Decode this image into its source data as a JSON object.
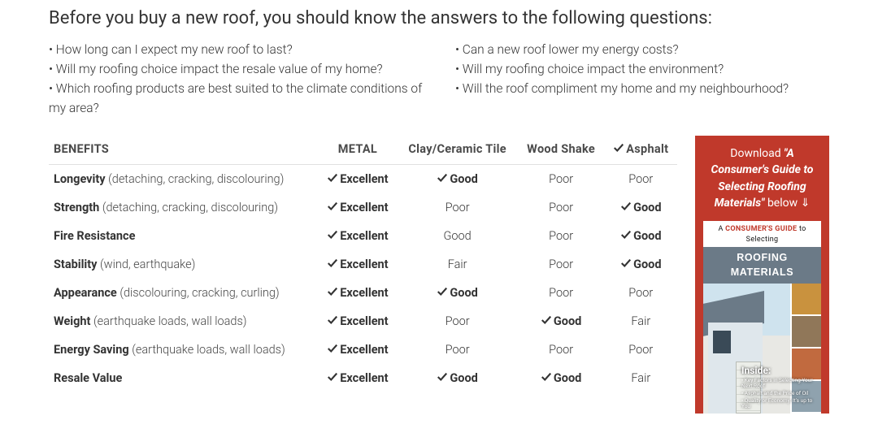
{
  "heading": "Before you buy a new roof, you should know the answers to the following questions:",
  "questions_left": [
    "• How long can I expect my new roof to last?",
    "• Will my roofing choice impact the resale value of my home?",
    "• Which roofing products are best suited to the climate conditions of my area?"
  ],
  "questions_right": [
    "• Can a new roof lower my energy costs?",
    "• Will my roofing choice impact the environment?",
    "• Will the roof compliment my home and my neighbourhood?"
  ],
  "table": {
    "columns": [
      {
        "label": "BENEFITS",
        "check": false
      },
      {
        "label": "METAL",
        "check": false
      },
      {
        "label": "Clay/Ceramic Tile",
        "check": false
      },
      {
        "label": "Wood Shake",
        "check": false
      },
      {
        "label": "Asphalt",
        "check": true
      }
    ],
    "rows": [
      {
        "name": "Longevity",
        "hint": "(detaching, cracking, discolouring)",
        "cells": [
          {
            "v": "Excellent",
            "s": true
          },
          {
            "v": "Good",
            "s": true
          },
          {
            "v": "Poor",
            "s": false
          },
          {
            "v": "Poor",
            "s": false
          }
        ]
      },
      {
        "name": "Strength",
        "hint": "(detaching, cracking, discolouring)",
        "cells": [
          {
            "v": "Excellent",
            "s": true
          },
          {
            "v": "Poor",
            "s": false
          },
          {
            "v": "Poor",
            "s": false
          },
          {
            "v": "Good",
            "s": true
          }
        ]
      },
      {
        "name": "Fire Resistance",
        "hint": "",
        "cells": [
          {
            "v": "Excellent",
            "s": true
          },
          {
            "v": "Good",
            "s": false
          },
          {
            "v": "Poor",
            "s": false
          },
          {
            "v": "Good",
            "s": true
          }
        ]
      },
      {
        "name": "Stability",
        "hint": "(wind, earthquake)",
        "cells": [
          {
            "v": "Excellent",
            "s": true
          },
          {
            "v": "Fair",
            "s": false
          },
          {
            "v": "Poor",
            "s": false
          },
          {
            "v": "Good",
            "s": true
          }
        ]
      },
      {
        "name": "Appearance",
        "hint": "(discolouring, cracking, curling)",
        "cells": [
          {
            "v": "Excellent",
            "s": true
          },
          {
            "v": "Good",
            "s": true
          },
          {
            "v": "Poor",
            "s": false
          },
          {
            "v": "Poor",
            "s": false
          }
        ]
      },
      {
        "name": "Weight",
        "hint": "(earthquake loads, wall loads)",
        "cells": [
          {
            "v": "Excellent",
            "s": true
          },
          {
            "v": "Poor",
            "s": false
          },
          {
            "v": "Good",
            "s": true
          },
          {
            "v": "Fair",
            "s": false
          }
        ]
      },
      {
        "name": "Energy Saving",
        "hint": "(earthquake loads, wall loads)",
        "cells": [
          {
            "v": "Excellent",
            "s": true
          },
          {
            "v": "Poor",
            "s": false
          },
          {
            "v": "Poor",
            "s": false
          },
          {
            "v": "Poor",
            "s": false
          }
        ]
      },
      {
        "name": "Resale Value",
        "hint": "",
        "cells": [
          {
            "v": "Excellent",
            "s": true
          },
          {
            "v": "Good",
            "s": true
          },
          {
            "v": "Good",
            "s": true
          },
          {
            "v": "Fair",
            "s": false
          }
        ]
      }
    ]
  },
  "sidebar": {
    "prefix": "Download ",
    "title": "\"A Consumer's Guide to Selecting Roofing Materials\"",
    "suffix": " below ⇓",
    "cover": {
      "bar_prefix": "A ",
      "bar_red": "CONSUMER'S GUIDE",
      "bar_suffix": " to Selecting",
      "title": "ROOFING MATERIALS",
      "inside_label": "Inside:",
      "bullets": [
        "• Key Factors in Selecting Your Next Roof",
        "• Asphalt and the Price of Oil",
        "• Quality or Economy: It's up to You"
      ]
    }
  }
}
